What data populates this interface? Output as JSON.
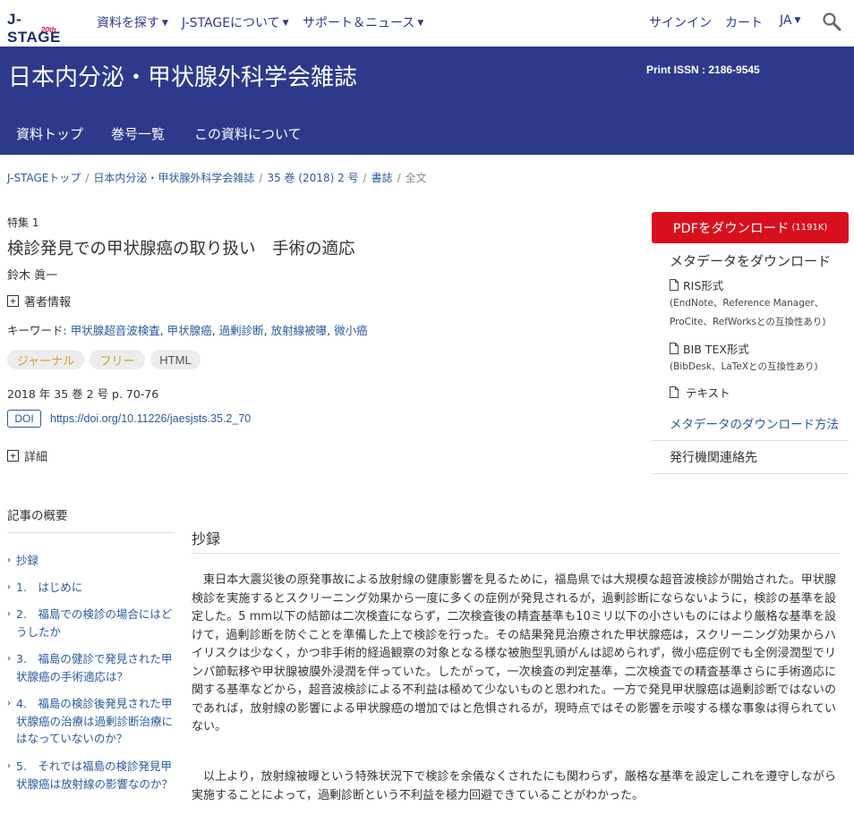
{
  "topnav": {
    "logo": "J-STAGE",
    "logo_badge": "20th",
    "items": [
      {
        "label": "資料を探す",
        "dropdown": true
      },
      {
        "label": "J-STAGEについて",
        "dropdown": true
      },
      {
        "label": "サポート＆ニュース",
        "dropdown": true
      }
    ],
    "signin": "サインイン",
    "cart": "カート",
    "lang": "JA"
  },
  "journal": {
    "title": "日本内分泌・甲状腺外科学会雑誌",
    "issn": "Print ISSN : 2186-9545",
    "tabs": [
      "資料トップ",
      "巻号一覧",
      "この資料について"
    ]
  },
  "breadcrumb": {
    "items": [
      "J-STAGEトップ",
      "日本内分泌・甲状腺外科学会雑誌",
      "35 巻 (2018) 2 号",
      "書誌"
    ],
    "current": "全文"
  },
  "article": {
    "feature": "特集 1",
    "title": "検診発見での甲状腺癌の取り扱い　手術の適応",
    "author": "鈴木 眞一",
    "author_info": "著者情報",
    "keywords_label": "キーワード:",
    "keywords": [
      "甲状腺超音波検査",
      "甲状腺癌",
      "過剰診断",
      "放射線被曝",
      "微小癌"
    ],
    "tags": [
      {
        "label": "ジャーナル",
        "color": "#c9a227"
      },
      {
        "label": "フリー",
        "color": "#b8a22a"
      },
      {
        "label": "HTML",
        "color": "#555555"
      }
    ],
    "volume": "2018 年 35 巻 2 号 p. 70-76",
    "doi_label": "DOI",
    "doi": "https://doi.org/10.11226/jaesjsts.35.2_70",
    "details": "詳細"
  },
  "sidebar": {
    "pdf_label": "PDFをダウンロード",
    "pdf_size": "(1191K)",
    "meta_heading": "メタデータをダウンロード",
    "ris": "RIS形式",
    "ris_compat_1": "(EndNote、Reference Manager、",
    "ris_compat_2": "ProCite、RefWorksとの互換性あり)",
    "bibtex": "BIB TEX形式",
    "bibtex_compat": "(BibDesk、LaTeXとの互換性あり)",
    "text": "テキスト",
    "howto": "メタデータのダウンロード方法",
    "publisher": "発行機関連絡先"
  },
  "outline": {
    "title": "記事の概要",
    "items": [
      "抄録",
      "1.　はじめに",
      "2.　福島での検診の場合にはどうしたか",
      "3.　福島の健診で発見された甲状腺癌の手術適応は？",
      "4.　福島の検診後発見された甲状腺癌の治療は過剰診断治療にはなっていないのか？",
      "5.　それでは福島の検診発見甲状腺癌は放射線の影響なのか？"
    ]
  },
  "abstract": {
    "title": "抄録",
    "para1": "東日本大震災後の原発事故による放射線の健康影響を見るために，福島県では大規模な超音波検診が開始された。甲状腺検診を実施するとスクリーニング効果から一度に多くの症例が発見されるが，過剰診断にならないように，検診の基準を設定した。5 mm以下の結節は二次検査にならず，二次検査後の精査基準も10ミリ以下の小さいものにはより厳格な基準を設けて，過剰診断を防ぐことを準備した上で検診を行った。その結果発見治療された甲状腺癌は，スクリーニング効果からハイリスクは少なく，かつ非手術的経過観察の対象となる様な被胞型乳頭がんは認められず，微小癌症例でも全例浸潤型でリンパ節転移や甲状腺被膜外浸潤を伴っていた。したがって，一次検査の判定基準，二次検査での精査基準さらに手術適応に関する基準などから，超音波検診による不利益は極めて少ないものと思われた。一方で発見甲状腺癌は過剰診断ではないのであれば，放射線の影響による甲状腺癌の増加ではと危惧されるが，現時点ではその影響を示唆する様な事象は得られていない。",
    "para2": "以上より，放射線被曝という特殊状況下で検診を余儀なくされたにも関わらず，厳格な基準を設定しこれを遵守しながら実施することによって，過剰診断という不利益を極力回避できていることがわかった。"
  }
}
